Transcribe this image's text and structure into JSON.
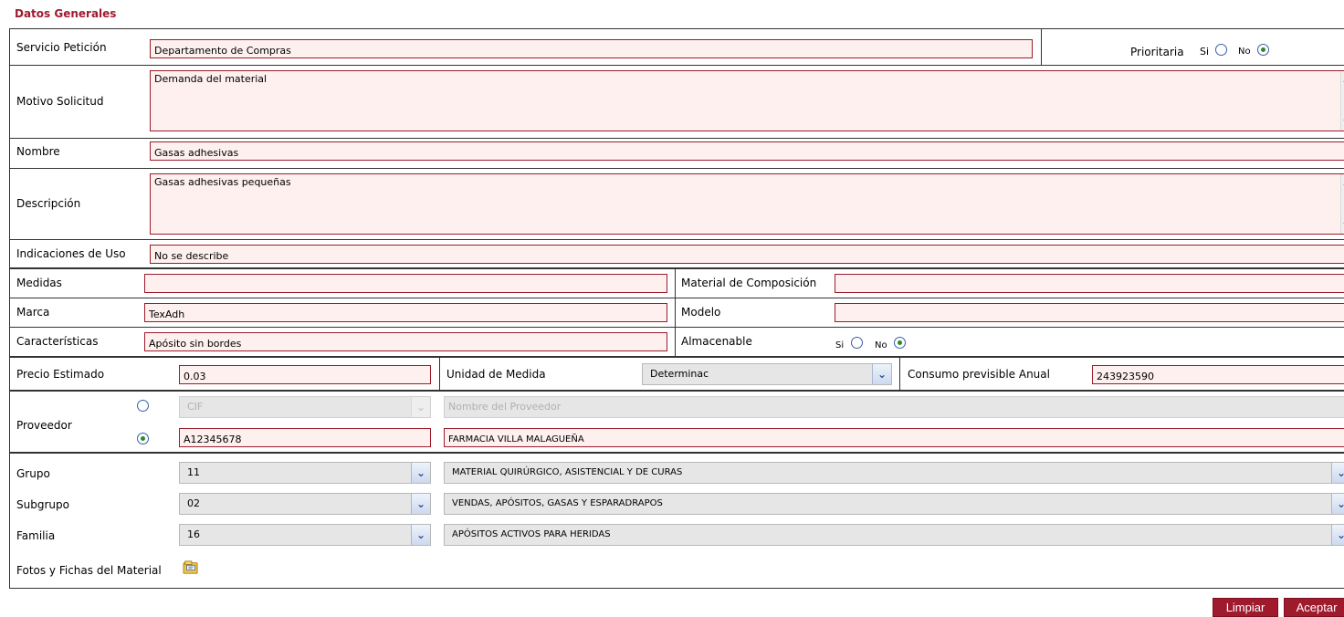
{
  "section_title": "Datos Generales",
  "servicio": {
    "label": "Servicio Petición",
    "value": "Departamento de Compras"
  },
  "prioritaria": {
    "label": "Prioritaria",
    "si": "Si",
    "no": "No",
    "selected": "No"
  },
  "motivo": {
    "label": "Motivo Solicitud",
    "value": "Demanda del material"
  },
  "nombre": {
    "label": "Nombre",
    "value": "Gasas adhesivas"
  },
  "descripcion": {
    "label": "Descripción",
    "value": "Gasas adhesivas pequeñas"
  },
  "indicaciones": {
    "label": "Indicaciones de Uso",
    "value": "No se describe"
  },
  "medidas": {
    "label": "Medidas",
    "value": ""
  },
  "material_composicion": {
    "label": "Material de Composición",
    "value": ""
  },
  "marca": {
    "label": "Marca",
    "value": "TexAdh"
  },
  "modelo": {
    "label": "Modelo",
    "value": ""
  },
  "caracteristicas": {
    "label": "Características",
    "value": "Apósito sin bordes"
  },
  "almacenable": {
    "label": "Almacenable",
    "si": "Si",
    "no": "No",
    "selected": "No"
  },
  "precio": {
    "label": "Precio Estimado",
    "value": "0.03"
  },
  "unidad": {
    "label": "Unidad de Medida",
    "value": "Determinac"
  },
  "consumo": {
    "label": "Consumo previsible Anual",
    "value": "243923590"
  },
  "proveedor": {
    "label": "Proveedor",
    "cif_placeholder": "CIF",
    "nombre_placeholder": "Nombre del Proveedor",
    "cif_value": "A12345678",
    "nombre_value": "FARMACIA VILLA MALAGUEÑA",
    "selected_option": 2
  },
  "grupo": {
    "label": "Grupo",
    "code": "11",
    "name": "MATERIAL QUIRÚRGICO, ASISTENCIAL Y DE CURAS"
  },
  "subgrupo": {
    "label": "Subgrupo",
    "code": "02",
    "name": "VENDAS, APÓSITOS, GASAS Y ESPARADRAPOS"
  },
  "familia": {
    "label": "Familia",
    "code": "16",
    "name": "APÓSITOS ACTIVOS PARA HERIDAS"
  },
  "fotos": {
    "label": "Fotos y Fichas del Material",
    "icon": "folder-icon"
  },
  "buttons": {
    "limpiar": "Limpiar",
    "aceptar": "Aceptar"
  },
  "colors": {
    "accent": "#a01a2e",
    "field_bg": "#fdf0ee",
    "field_border": "#9a1c2a",
    "radio_checked": "#2b8a2b"
  }
}
